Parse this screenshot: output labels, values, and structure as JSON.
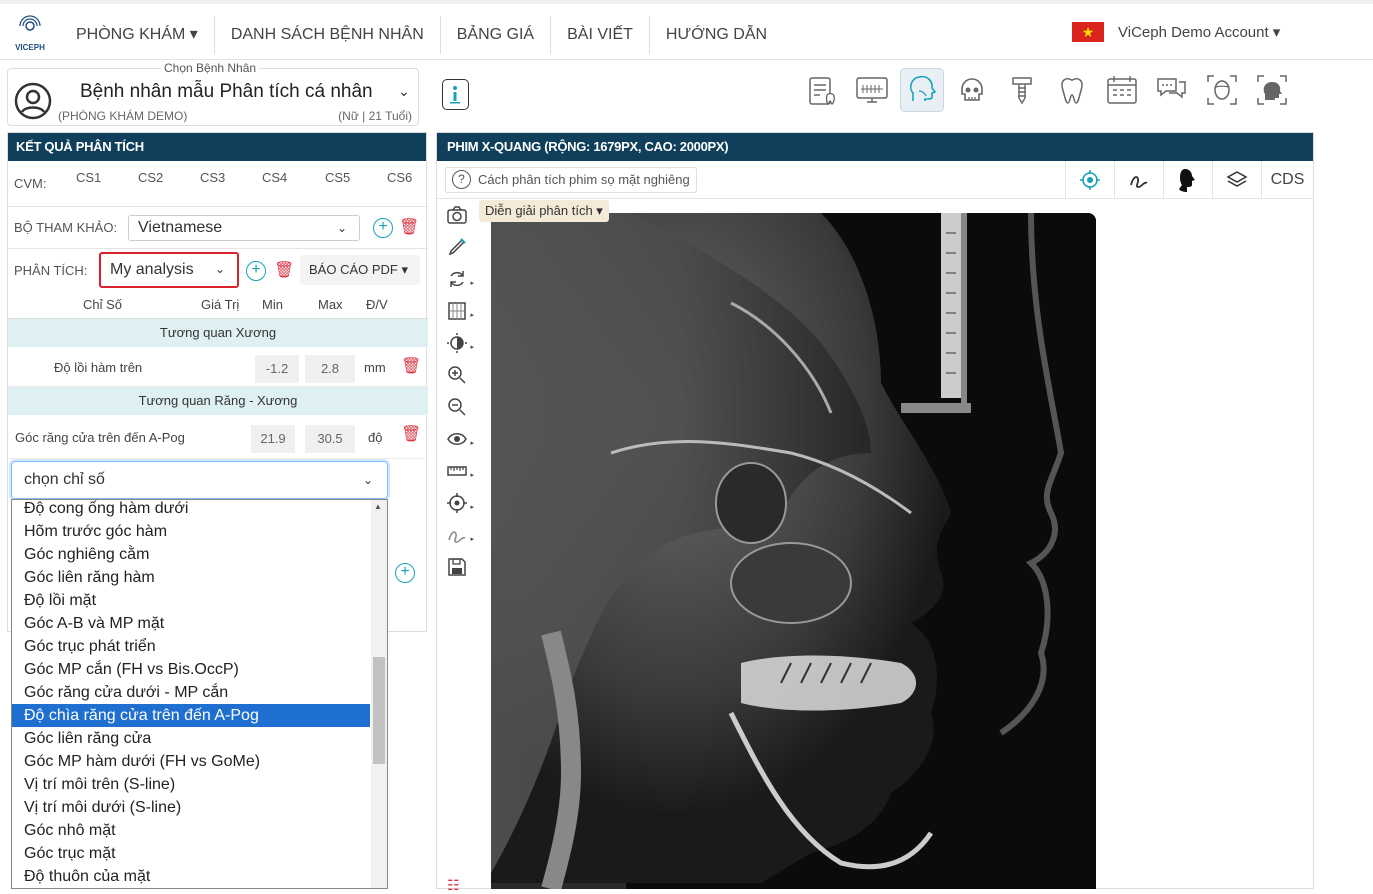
{
  "nav": {
    "logo_text": "VICEPH",
    "items": [
      "PHÒNG KHÁM ▾",
      "DANH SÁCH BỆNH NHÂN",
      "BẢNG GIÁ",
      "BÀI VIẾT",
      "HƯỚNG DẪN"
    ],
    "account": "ViCeph Demo Account ▾"
  },
  "patient": {
    "label": "Chọn Bệnh Nhân",
    "name": "Bệnh nhân mẫu Phân tích cá nhân",
    "clinic": "(PHÒNG KHÁM DEMO)",
    "info": "(Nữ | 21 Tuổi)"
  },
  "left": {
    "title": "KẾT QUẢ PHÂN TÍCH",
    "cvm_label": "CVM:",
    "cvm": [
      "CS1",
      "CS2",
      "CS3",
      "CS4",
      "CS5",
      "CS6"
    ],
    "ref_label": "BỘ THAM KHẢO:",
    "ref_value": "Vietnamese",
    "analysis_label": "PHÂN TÍCH:",
    "analysis_value": "My analysis",
    "pdf_label": "BÁO CÁO PDF ▾",
    "table": {
      "headers": [
        "Chỉ Số",
        "Giá Trị",
        "Min",
        "Max",
        "Đ/V"
      ],
      "groups": [
        {
          "name": "Tương quan Xương",
          "row": {
            "name": "Độ lồi hàm trên",
            "value": "",
            "min": "-1.2",
            "max": "2.8",
            "unit": "mm"
          }
        },
        {
          "name": "Tương quan Răng - Xương",
          "row": {
            "name": "Góc răng cửa trên đến A-Pog",
            "value": "",
            "min": "21.9",
            "max": "30.5",
            "unit": "độ"
          }
        }
      ]
    },
    "select_placeholder": "chọn chỉ số",
    "options": [
      "Độ cong ống hàm dưới",
      "Hõm trước góc hàm",
      "Góc nghiêng cằm",
      "Góc liên răng hàm",
      "Độ lồi mặt",
      "Góc A-B và MP mặt",
      "Góc trục phát triển",
      "Góc MP cắn (FH vs Bis.OccP)",
      "Góc răng cửa dưới - MP cắn",
      "Độ chìa răng cửa trên đến A-Pog",
      "Góc liên răng cửa",
      "Góc MP hàm dưới (FH vs GoMe)",
      "Vị trí môi trên (S-line)",
      "Vị trí môi dưới (S-line)",
      "Góc nhô mặt",
      "Góc trục mặt",
      "Độ thuôn của mặt"
    ],
    "highlighted_index": 9
  },
  "right": {
    "title": "PHIM X-QUANG (RỘNG: 1679PX, CAO: 2000PX)",
    "hint": "Cách phân tích phim sọ mặt nghiêng",
    "cds": "CDS",
    "badge": "Diễn giải phân tích ▾"
  },
  "colors": {
    "header": "#0f3f5a",
    "accent": "#17a2b8",
    "danger": "#dc3545",
    "highlight": "#1e6fd0"
  }
}
